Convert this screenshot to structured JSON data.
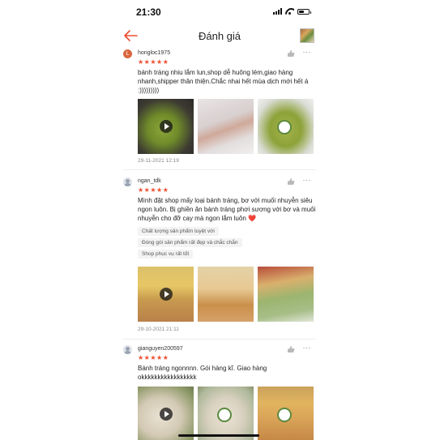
{
  "status_bar": {
    "time": "21:30",
    "battery_level": 0.5
  },
  "header": {
    "title": "Đánh giá",
    "back_icon": "arrow-left-icon",
    "accent": "#ee4d2d"
  },
  "reviews": [
    {
      "avatar_letter": "L",
      "username": "hongloc1975",
      "rating": 5,
      "stars": "★★★★★",
      "text": "bánh tráng nhiu lắm lun,shop dễ huông lém,giao hàng nhanh,shipper thân thiện.Chắc nhai hết mùa dịch mới hết á :)))))))))",
      "tags": [],
      "date": "29-11-2021 12:19"
    },
    {
      "avatar_letter": "",
      "username": "ngan_tdk",
      "rating": 5,
      "stars": "★★★★★",
      "text": "Mình đặt shop mấy loại bánh tráng, bơ với muối nhuyễn siêu ngon luôn. Bị ghiền ăn bánh tráng phơi sương với bơ và muối nhuyễn cho đỡ cay mà ngon lắm luôn ❤️",
      "tags": [
        "Chất lượng sản phẩm tuyệt vời",
        "Đóng gói sản phẩm rất đẹp và chắc chắn",
        "Shop phục vụ rất tốt"
      ],
      "date": "29-10-2021 21:11"
    },
    {
      "avatar_letter": "",
      "username": "gianguyen200597",
      "rating": 5,
      "stars": "★★★★★",
      "text": "Bánh tráng ngonnnn. Gói hàng kĩ. Giao hàng okkkkkkkkkkkkkkkkk",
      "tags": [],
      "date": ""
    }
  ]
}
